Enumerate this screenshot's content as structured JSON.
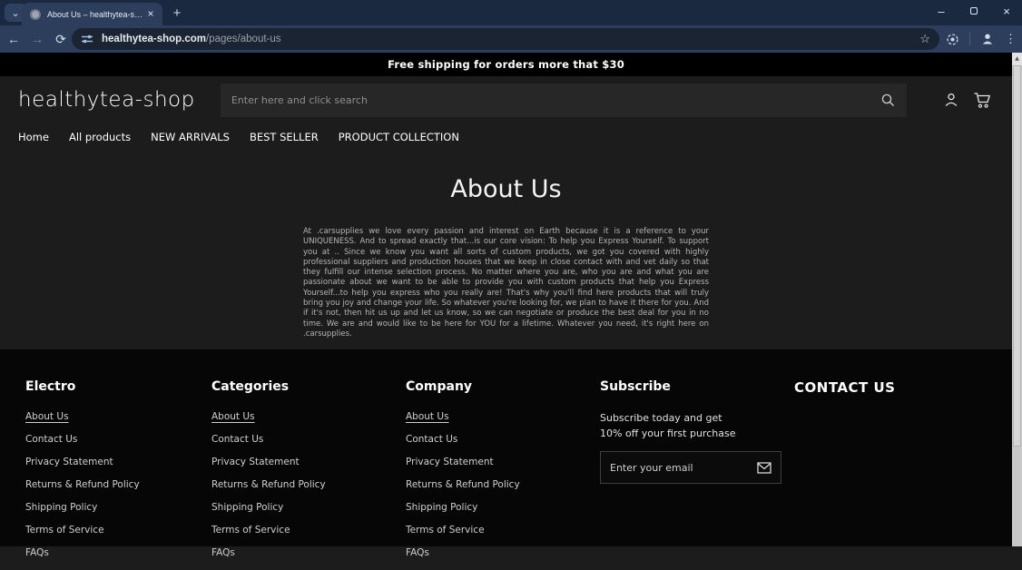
{
  "browser": {
    "tab_title": "About Us – healthytea-shop",
    "url": {
      "domain": "healthytea-shop.com",
      "path": "/pages/about-us"
    },
    "glyphs": {
      "tab_search": "⌄",
      "new_tab": "+",
      "tab_close": "×",
      "back": "←",
      "forward": "→",
      "refresh": "⟳",
      "star": "☆",
      "menu_dots": "⋮",
      "minimize": "–",
      "close_window": "×",
      "scroll_up": "▲"
    }
  },
  "announcement": {
    "text": "Free shipping for orders more that $30"
  },
  "header": {
    "logo": "healthytea-shop",
    "search_placeholder": "Enter here and click search"
  },
  "nav": {
    "items": [
      "Home",
      "All products",
      "NEW ARRIVALS",
      "BEST SELLER",
      "PRODUCT COLLECTION"
    ]
  },
  "main": {
    "title": "About Us",
    "body": "At .carsupplies we love every passion and interest on Earth because it is a reference to your UNIQUENESS. And to spread exactly that...is our core vision: To help you Express Yourself. To support you at .. Since we know you want all sorts of custom products, we got you covered with highly professional suppliers and production houses that we keep in close contact with and vet daily so that they fulfill our intense selection process. No matter where you are, who you are and what you are passionate about we want to be able to provide you with custom products that help you Express Yourself...to help you express who you really are! That's why you'll find here products that will truly bring you joy and change your life. So whatever you're looking for, we plan to have it there for you. And if it's not, then hit us up and let us know, so we can negotiate or produce the best deal for you in no time. We are and would like to be here for YOU for a lifetime. Whatever you need, it's right here on .carsupplies."
  },
  "footer": {
    "columns": [
      {
        "heading": "Electro"
      },
      {
        "heading": "Categories"
      },
      {
        "heading": "Company"
      }
    ],
    "links": [
      "About Us",
      "Contact Us",
      "Privacy Statement",
      "Returns & Refund Policy",
      "Shipping Policy",
      "Terms of Service",
      "FAQs"
    ],
    "subscribe": {
      "heading": "Subscribe",
      "text": "Subscribe today and get 10% off your first purchase",
      "email_placeholder": "Enter your email"
    },
    "contact": {
      "heading": "CONTACT US"
    }
  },
  "colors": {
    "chrome_frame": "#1b2940",
    "chrome_toolbar": "#2c3e5c",
    "omnibox": "#1a2433",
    "announcement_bg": "#000000",
    "page_bg": "#1c1c1c",
    "footer_bg": "#060606",
    "text_primary": "#ffffff",
    "text_muted": "#b5b5b5"
  }
}
